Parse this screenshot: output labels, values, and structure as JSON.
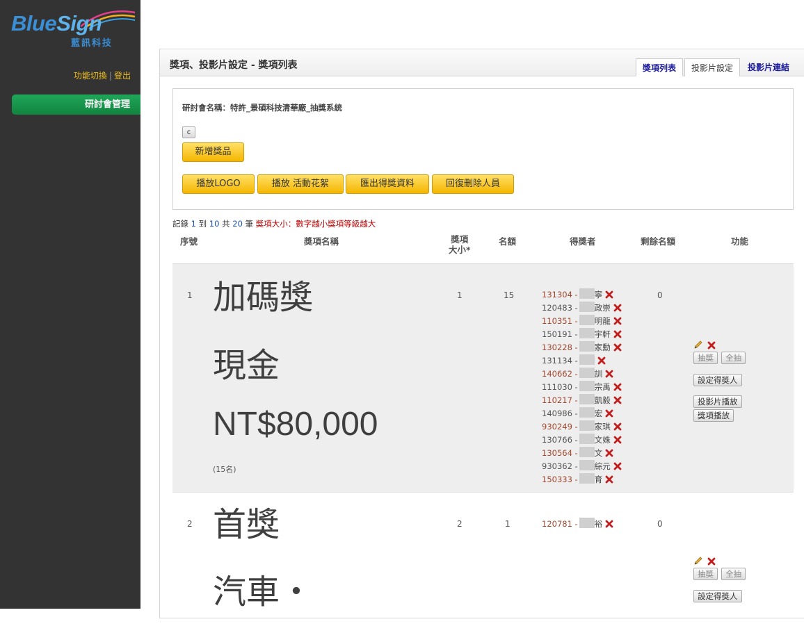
{
  "brand": {
    "logo_name": "BlueSign",
    "logo_sub": "藍訊科技",
    "blue": "#3a8fd6",
    "accent_green": "#1fa659",
    "accent_yellow": "#f5b600"
  },
  "header_links": {
    "switch": "功能切換",
    "sep": "|",
    "logout": "登出"
  },
  "nav": {
    "seminar_admin": "研討會管理"
  },
  "panel": {
    "title": "獎項、投影片設定 - 獎項列表"
  },
  "tabs": [
    {
      "label": "獎項列表",
      "state": "active"
    },
    {
      "label": "投影片設定",
      "state": "normal"
    },
    {
      "label": "投影片連結",
      "state": "link"
    }
  ],
  "seminar": {
    "label": "研討會名稱：特許_景碩科技清華廠_抽獎系統"
  },
  "buttons": {
    "c": "c",
    "add_prize": "新增獎品",
    "play_logo": "播放LOGO",
    "play_event": "播放 活動花絮",
    "export": "匯出得獎資料",
    "restore": "回復刪除人員"
  },
  "records": {
    "prefix": "記錄",
    "from": "1",
    "to_label": "到",
    "to": "10",
    "total_label": "共",
    "total": "20",
    "unit": "筆",
    "size_hint": "獎項大小：",
    "size_desc": "數字越小獎項等級越大"
  },
  "columns": {
    "seq": "序號",
    "name": "獎項名稱",
    "size_line1": "獎項",
    "size_line2": "大小*",
    "quota": "名額",
    "winners": "得獎者",
    "remaining": "剩餘名額",
    "func": "功能"
  },
  "row_actions": {
    "draw": "抽獎",
    "draw_all": "全抽",
    "set_winner": "設定得獎人",
    "slide_play": "投影片播放",
    "prize_play": "獎項播放"
  },
  "rows": [
    {
      "seq": "1",
      "lines": [
        "加碼獎",
        "現金",
        "NT$80,000"
      ],
      "note": "(15名)",
      "size": "1",
      "quota": "15",
      "remaining": "0",
      "winners": [
        {
          "id": "131304 -",
          "name": "寧"
        },
        {
          "id": "120483 -",
          "name": "政崇"
        },
        {
          "id": "110351 -",
          "name": "明龍"
        },
        {
          "id": "150191 -",
          "name": "宇軒"
        },
        {
          "id": "130228 -",
          "name": "家勳"
        },
        {
          "id": "131134 -",
          "name": ""
        },
        {
          "id": "140662 -",
          "name": "訓"
        },
        {
          "id": "111030 -",
          "name": "宗禹"
        },
        {
          "id": "110217 -",
          "name": "凱毅"
        },
        {
          "id": "140986 -",
          "name": "宏"
        },
        {
          "id": "930249 -",
          "name": "家琪"
        },
        {
          "id": "130766 -",
          "name": "文姝"
        },
        {
          "id": "130564 -",
          "name": "文"
        },
        {
          "id": "930362 -",
          "name": "綜元"
        },
        {
          "id": "150333 -",
          "name": "育"
        }
      ]
    },
    {
      "seq": "2",
      "lines": [
        "首獎",
        "汽車・"
      ],
      "note": "",
      "size": "2",
      "quota": "1",
      "remaining": "0",
      "winners": [
        {
          "id": "120781 -",
          "name": "裕"
        }
      ]
    }
  ]
}
